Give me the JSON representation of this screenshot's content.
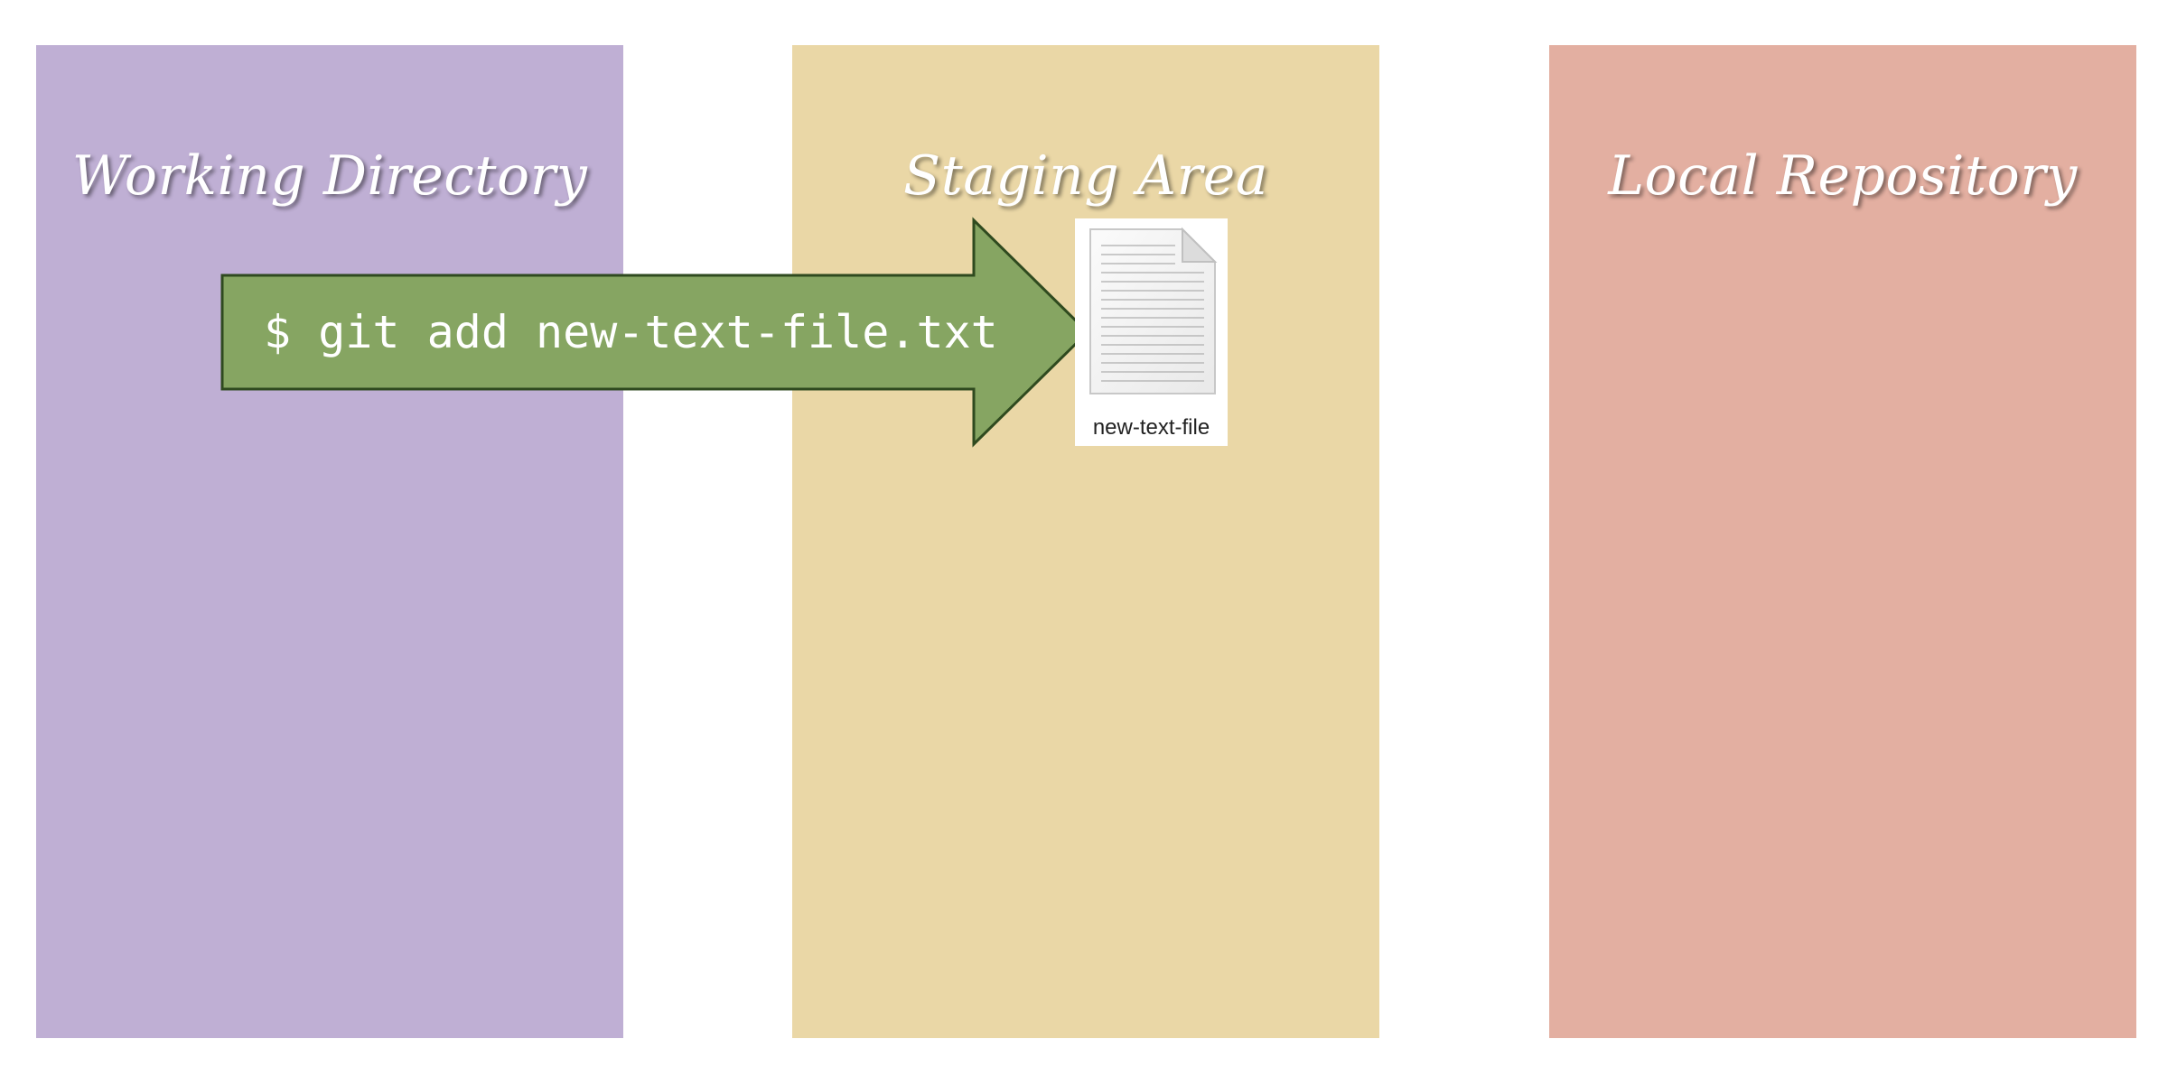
{
  "panels": [
    {
      "title": "Working Directory",
      "color": "#bfafd4"
    },
    {
      "title": "Staging Area",
      "color": "#ead7a6"
    },
    {
      "title": "Local Repository",
      "color": "#e3afa1"
    }
  ],
  "arrow": {
    "command": "$ git add new-text-file.txt",
    "color": "#86a562",
    "border_color": "#2f4a1f"
  },
  "file": {
    "name": "new-text-file",
    "icon": "text-file-icon"
  }
}
